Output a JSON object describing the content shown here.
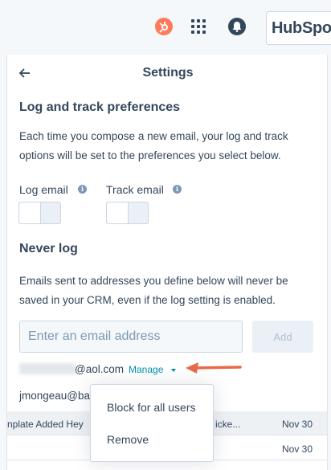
{
  "topbar": {
    "brand": "HubSpot"
  },
  "panel": {
    "title": "Settings",
    "log_track": {
      "heading": "Log and track preferences",
      "description": "Each time you compose a new email, your log and track options will be set to the preferences you select below.",
      "log_email_label": "Log email",
      "track_email_label": "Track email"
    },
    "never_log": {
      "heading": "Never log",
      "description": "Emails sent to addresses you define below will never be saved in your CRM, even if the log setting is enabled.",
      "input_placeholder": "Enter an email address",
      "add_label": "Add",
      "entries": [
        {
          "email": "@aol.com",
          "action": "Manage"
        },
        {
          "email": "jmongeau@ba"
        }
      ]
    }
  },
  "background": {
    "rows": [
      {
        "text": "nplate Added Hey",
        "text2": "icke...",
        "date": "Nov 30"
      },
      {
        "text": "",
        "text2": "",
        "date": "Nov 30"
      }
    ]
  },
  "dropdown": {
    "items": [
      "Block for all users",
      "Remove"
    ]
  },
  "colors": {
    "accent": "#ff7a59",
    "link": "#0091ae",
    "text": "#33475b"
  }
}
